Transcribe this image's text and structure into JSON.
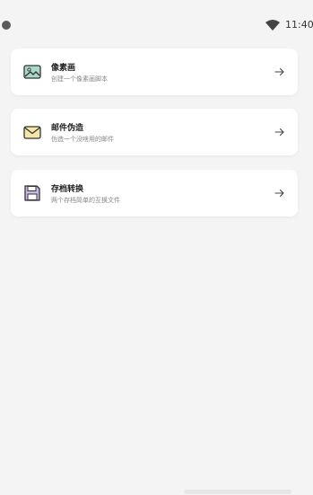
{
  "status_bar": {
    "time": "11:40",
    "icons": [
      "status-dot",
      "wifi-icon"
    ]
  },
  "cards": [
    {
      "title": "像素画",
      "subtitle": "创建一个像素画脚本",
      "icon": "image-icon",
      "arrow": "arrow-right-icon"
    },
    {
      "title": "邮件伪造",
      "subtitle": "伪造一个没啥用的邮件",
      "icon": "mail-icon",
      "arrow": "arrow-right-icon"
    },
    {
      "title": "存档转换",
      "subtitle": "两个存档简单的互换文件",
      "icon": "save-icon",
      "arrow": "arrow-right-icon"
    }
  ],
  "colors": {
    "background": "#f4f4f4",
    "card": "#ffffff",
    "image_icon_fill": "#a8d8c8",
    "mail_icon_fill": "#f5e6a8",
    "save_icon_fill": "#c9b8e8"
  }
}
